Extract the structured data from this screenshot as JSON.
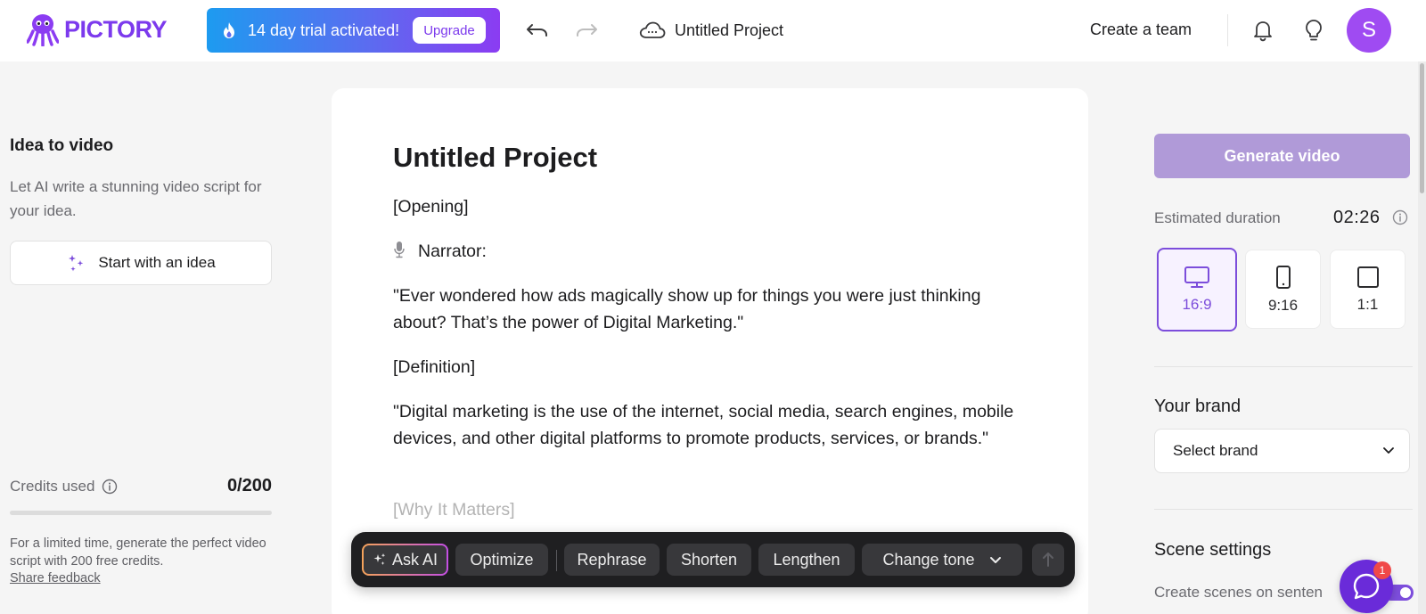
{
  "header": {
    "brand": "PICTORY",
    "trial_text": "14 day trial activated!",
    "upgrade_label": "Upgrade",
    "project_title": "Untitled Project",
    "create_team_label": "Create a team",
    "avatar_initial": "S"
  },
  "left_panel": {
    "title": "Idea to video",
    "description": "Let AI write a stunning video script for your idea.",
    "start_button_label": "Start with an idea",
    "credits_label": "Credits used",
    "credits_value": "0/200",
    "credits_used_fraction": 0.0,
    "promo_text": "For a limited time, generate the perfect video script with 200 free credits.",
    "feedback_link": "Share feedback"
  },
  "editor": {
    "title": "Untitled Project",
    "paragraphs": [
      "[Opening]",
      "Narrator:",
      "\"Ever wondered how ads magically show up for things you were just thinking about? That’s the power of Digital Marketing.\"",
      "[Definition]",
      "\"Digital marketing is the use of the internet, social media, search engines, mobile devices, and other digital platforms to promote products, services, or brands.\"",
      "[Why It Matters]"
    ]
  },
  "toolbar": {
    "ask_ai": "Ask AI",
    "optimize": "Optimize",
    "rephrase": "Rephrase",
    "shorten": "Shorten",
    "lengthen": "Lengthen",
    "change_tone": "Change tone"
  },
  "right_panel": {
    "generate_label": "Generate video",
    "estimated_label": "Estimated duration",
    "estimated_value": "02:26",
    "ratios": [
      "16:9",
      "9:16",
      "1:1"
    ],
    "selected_ratio": "16:9",
    "brand_section_title": "Your brand",
    "brand_select_value": "Select brand",
    "scene_section_title": "Scene settings",
    "scene_option_label": "Create scenes on senten",
    "chat_badge_count": "1"
  },
  "colors": {
    "accent": "#7c3aed",
    "generate_disabled": "#b09ad8",
    "toolbar_bg": "#1f1f21"
  }
}
